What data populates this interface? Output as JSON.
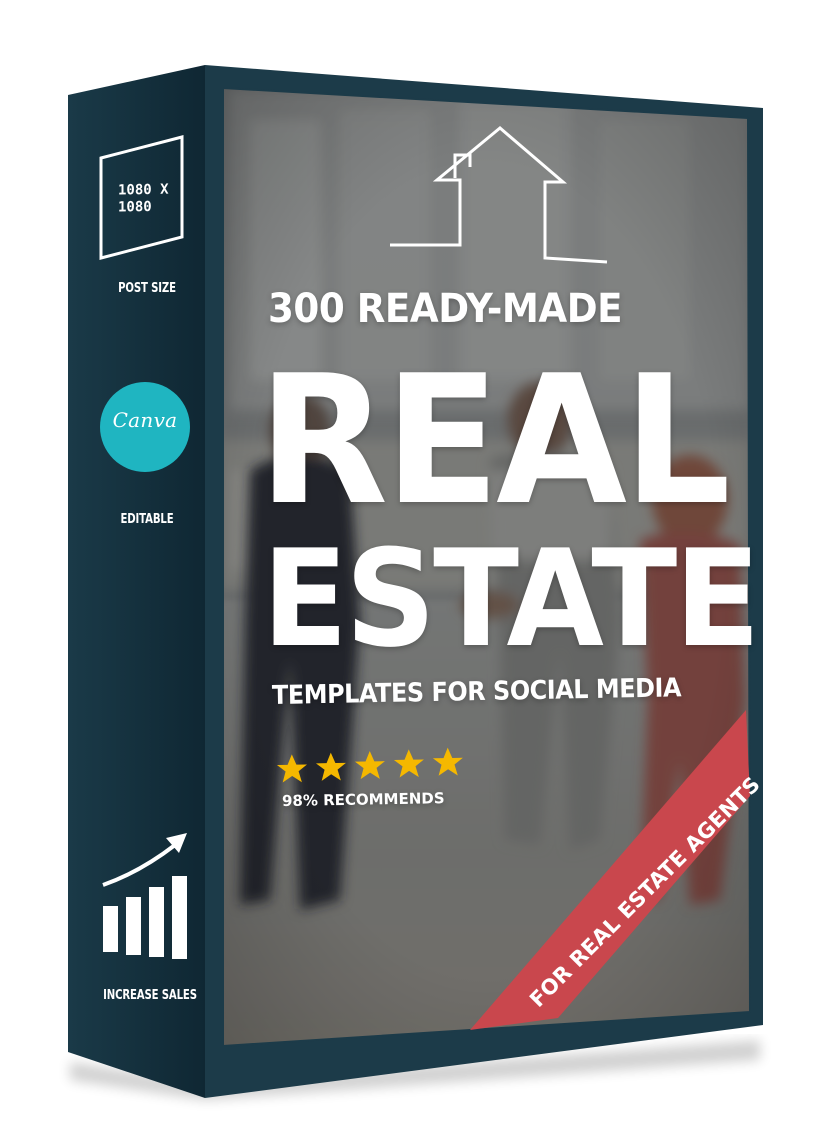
{
  "spine": {
    "size_value": "1080 X\n1080",
    "size_label": "POST SIZE",
    "canva_logo": "Canva",
    "editable_label": "EDITABLE",
    "sales_label": "INCREASE SALES"
  },
  "cover": {
    "subtitle": "300 READY-MADE",
    "headline_line1": "REAL",
    "headline_line2": "ESTATE",
    "tagline": "TEMPLATES FOR SOCIAL MEDIA",
    "rating_stars": 5,
    "recommend_text": "98% RECOMMENDS",
    "ribbon_text": "FOR REAL ESTATE AGENTS"
  },
  "colors": {
    "spine": "#15303d",
    "cover_frame": "#1c3b49",
    "ribbon": "#c9474d",
    "star": "#f5b800",
    "canva": "#1fb5c1",
    "text": "#ffffff"
  },
  "icons": [
    "house-outline-icon",
    "canva-logo",
    "growth-chart-icon",
    "star-icon"
  ]
}
